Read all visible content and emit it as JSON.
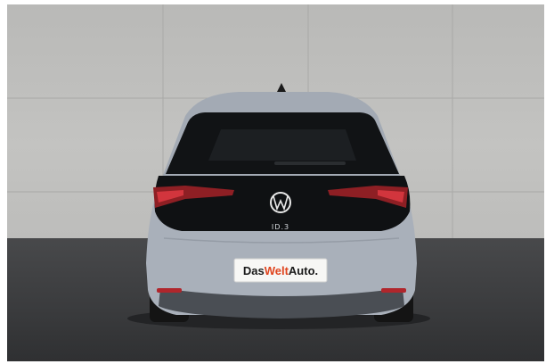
{
  "photo": {
    "subject": "Volkswagen ID.3 rear view",
    "wall_color": "#bdbdbb",
    "floor_color": "#3f4042",
    "car_body_color": "#a9b0ba"
  },
  "car": {
    "badge_text": "ID.3",
    "dealer_plate": {
      "part1": "Das",
      "part2": "Welt",
      "part3": "Auto.",
      "accent_color": "#e0451f"
    }
  }
}
